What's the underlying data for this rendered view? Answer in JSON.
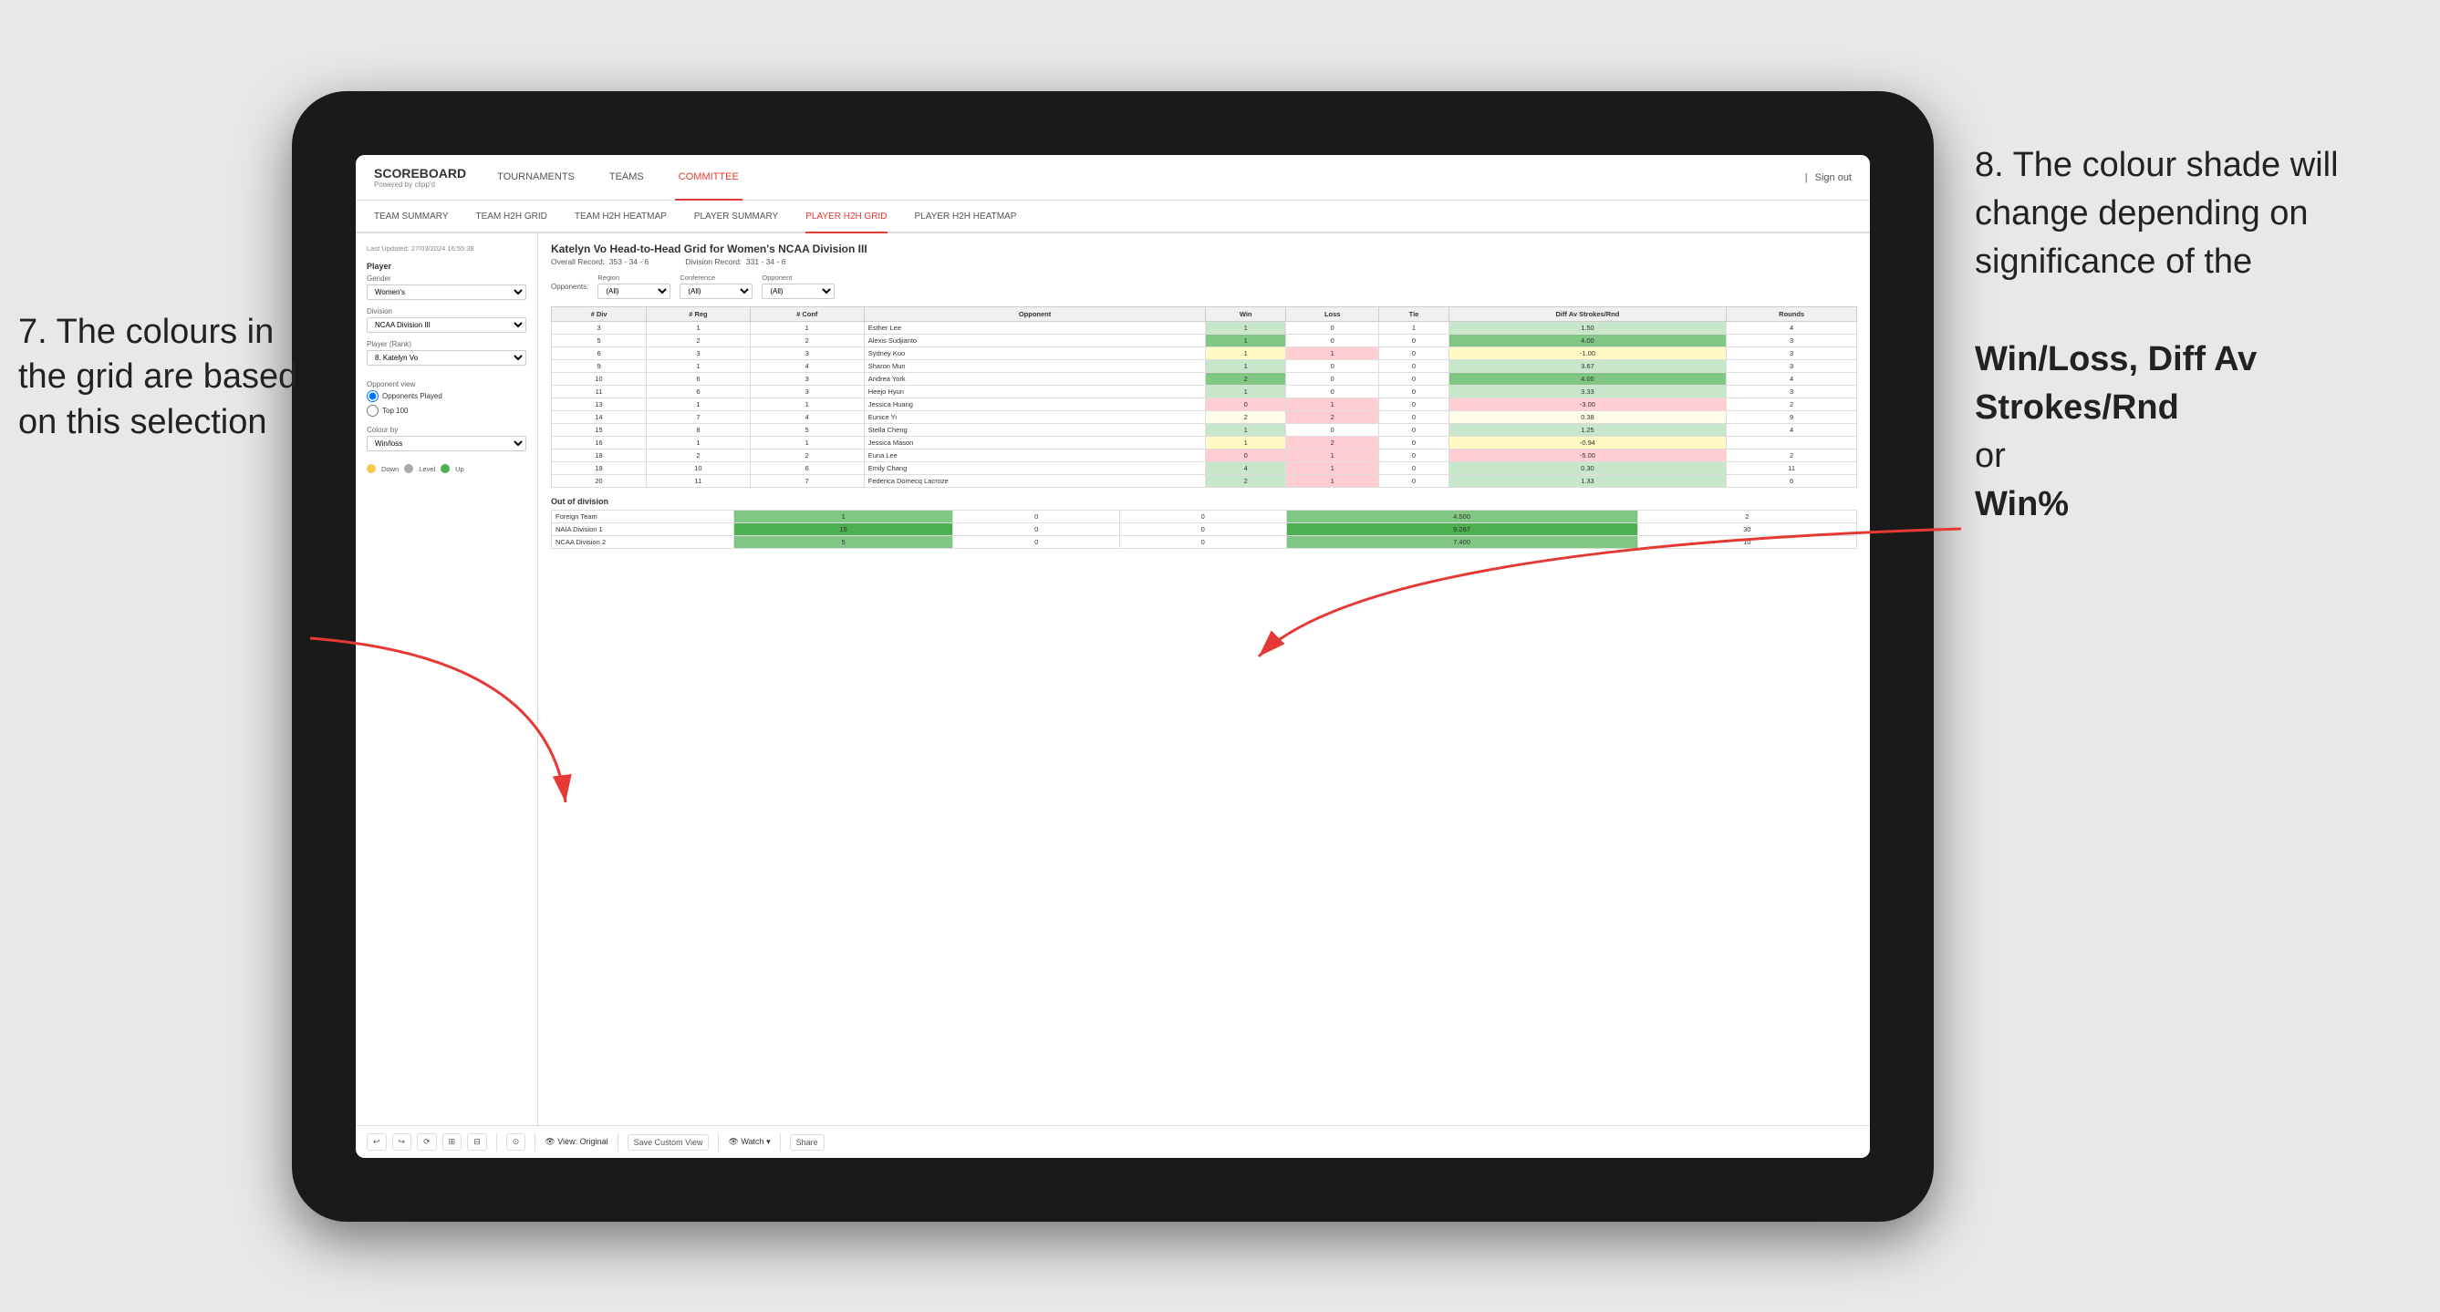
{
  "annotations": {
    "left_title": "7. The colours in the grid are based on this selection",
    "right_title": "8. The colour shade will change depending on significance of the",
    "right_bold1": "Win/Loss,",
    "right_bold2": "Diff Av Strokes/Rnd",
    "right_text": "or",
    "right_bold3": "Win%"
  },
  "nav": {
    "logo": "SCOREBOARD",
    "logo_sub": "Powered by clipp'd",
    "items": [
      "TOURNAMENTS",
      "TEAMS",
      "COMMITTEE"
    ],
    "active": "COMMITTEE",
    "sign_out": "Sign out"
  },
  "sub_nav": {
    "items": [
      "TEAM SUMMARY",
      "TEAM H2H GRID",
      "TEAM H2H HEATMAP",
      "PLAYER SUMMARY",
      "PLAYER H2H GRID",
      "PLAYER H2H HEATMAP"
    ],
    "active": "PLAYER H2H GRID"
  },
  "sidebar": {
    "timestamp": "Last Updated: 27/03/2024 16:55:38",
    "player_section": "Player",
    "gender_label": "Gender",
    "gender_value": "Women's",
    "division_label": "Division",
    "division_value": "NCAA Division III",
    "player_rank_label": "Player (Rank)",
    "player_rank_value": "8. Katelyn Vo",
    "opponent_view_label": "Opponent view",
    "radio1": "Opponents Played",
    "radio2": "Top 100",
    "colour_by_label": "Colour by",
    "colour_by_value": "Win/loss",
    "legend": {
      "down_label": "Down",
      "level_label": "Level",
      "up_label": "Up"
    }
  },
  "grid": {
    "title": "Katelyn Vo Head-to-Head Grid for Women's NCAA Division III",
    "overall_record_label": "Overall Record:",
    "overall_record": "353 - 34 - 6",
    "division_record_label": "Division Record:",
    "division_record": "331 - 34 - 6",
    "opponents_label": "Opponents:",
    "opponents_value": "(All)",
    "region_label": "Region",
    "conference_label": "Conference",
    "opponent_label": "Opponent",
    "region_value": "(All)",
    "conference_value": "(All)",
    "opponent_value": "(All)",
    "table_headers": [
      "# Div",
      "# Reg",
      "# Conf",
      "Opponent",
      "Win",
      "Loss",
      "Tie",
      "Diff Av Strokes/Rnd",
      "Rounds"
    ],
    "rows": [
      {
        "div": "3",
        "reg": "1",
        "conf": "1",
        "opponent": "Esther Lee",
        "win": "1",
        "loss": "0",
        "tie": "1",
        "diff": "1.50",
        "rounds": "4",
        "color": "green-light"
      },
      {
        "div": "5",
        "reg": "2",
        "conf": "2",
        "opponent": "Alexis Sudjianto",
        "win": "1",
        "loss": "0",
        "tie": "0",
        "diff": "4.00",
        "rounds": "3",
        "color": "green-medium"
      },
      {
        "div": "6",
        "reg": "3",
        "conf": "3",
        "opponent": "Sydney Kuo",
        "win": "1",
        "loss": "1",
        "tie": "0",
        "diff": "-1.00",
        "rounds": "3",
        "color": "yellow"
      },
      {
        "div": "9",
        "reg": "1",
        "conf": "4",
        "opponent": "Sharon Mun",
        "win": "1",
        "loss": "0",
        "tie": "0",
        "diff": "3.67",
        "rounds": "3",
        "color": "green-light"
      },
      {
        "div": "10",
        "reg": "6",
        "conf": "3",
        "opponent": "Andrea York",
        "win": "2",
        "loss": "0",
        "tie": "0",
        "diff": "4.00",
        "rounds": "4",
        "color": "green-medium"
      },
      {
        "div": "11",
        "reg": "6",
        "conf": "3",
        "opponent": "Heejo Hyun",
        "win": "1",
        "loss": "0",
        "tie": "0",
        "diff": "3.33",
        "rounds": "3",
        "color": "green-light"
      },
      {
        "div": "13",
        "reg": "1",
        "conf": "1",
        "opponent": "Jessica Huang",
        "win": "0",
        "loss": "1",
        "tie": "0",
        "diff": "-3.00",
        "rounds": "2",
        "color": "red-light"
      },
      {
        "div": "14",
        "reg": "7",
        "conf": "4",
        "opponent": "Eunice Yi",
        "win": "2",
        "loss": "2",
        "tie": "0",
        "diff": "0.38",
        "rounds": "9",
        "color": "yellow-light"
      },
      {
        "div": "15",
        "reg": "8",
        "conf": "5",
        "opponent": "Stella Cheng",
        "win": "1",
        "loss": "0",
        "tie": "0",
        "diff": "1.25",
        "rounds": "4",
        "color": "green-light"
      },
      {
        "div": "16",
        "reg": "1",
        "conf": "1",
        "opponent": "Jessica Mason",
        "win": "1",
        "loss": "2",
        "tie": "0",
        "diff": "-0.94",
        "rounds": "",
        "color": "yellow"
      },
      {
        "div": "18",
        "reg": "2",
        "conf": "2",
        "opponent": "Euna Lee",
        "win": "0",
        "loss": "1",
        "tie": "0",
        "diff": "-5.00",
        "rounds": "2",
        "color": "red-light"
      },
      {
        "div": "19",
        "reg": "10",
        "conf": "6",
        "opponent": "Emily Chang",
        "win": "4",
        "loss": "1",
        "tie": "0",
        "diff": "0.30",
        "rounds": "11",
        "color": "green-light"
      },
      {
        "div": "20",
        "reg": "11",
        "conf": "7",
        "opponent": "Federica Domecq Lacroze",
        "win": "2",
        "loss": "1",
        "tie": "0",
        "diff": "1.33",
        "rounds": "6",
        "color": "green-light"
      }
    ],
    "out_of_division_label": "Out of division",
    "out_rows": [
      {
        "name": "Foreign Team",
        "win": "1",
        "loss": "0",
        "tie": "0",
        "diff": "4.500",
        "rounds": "2",
        "color": "green-medium"
      },
      {
        "name": "NAIA Division 1",
        "win": "15",
        "loss": "0",
        "tie": "0",
        "diff": "9.267",
        "rounds": "30",
        "color": "green-dark"
      },
      {
        "name": "NCAA Division 2",
        "win": "5",
        "loss": "0",
        "tie": "0",
        "diff": "7.400",
        "rounds": "10",
        "color": "green-medium"
      }
    ]
  },
  "toolbar": {
    "view_original": "View: Original",
    "save_custom": "Save Custom View",
    "watch": "Watch",
    "share": "Share"
  }
}
